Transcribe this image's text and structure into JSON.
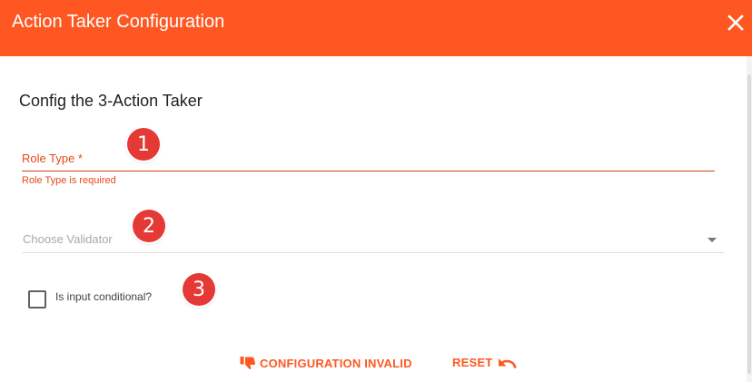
{
  "dialog": {
    "title": "Action Taker Configuration",
    "close_icon": "close-icon",
    "heading": "Config the 3-Action Taker"
  },
  "form": {
    "role_type_label": "Role Type *",
    "role_type_value": "",
    "role_type_error": "Role Type is required",
    "validator_placeholder": "Choose Validator",
    "conditional_label": "Is input conditional?",
    "conditional_checked": false
  },
  "annotations": [
    "1",
    "2",
    "3"
  ],
  "actions": {
    "invalid_label": "CONFIGURATION INVALID",
    "invalid_icon": "thumbs-down-icon",
    "reset_label": "RESET",
    "reset_icon": "undo-icon"
  },
  "colors": {
    "header_bg": "#ff5722",
    "accent": "#ff5722",
    "error": "#e64a19",
    "badge": "#e53935"
  }
}
